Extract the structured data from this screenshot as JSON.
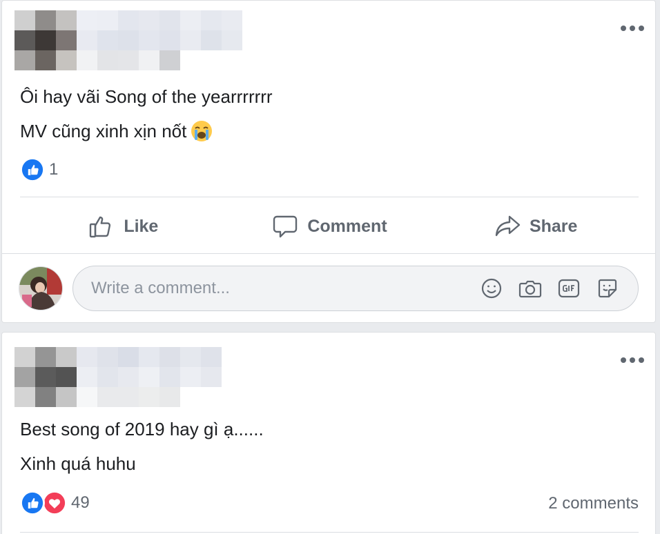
{
  "posts": [
    {
      "lines": [
        "Ôi hay vãi Song of the yearrrrrrr",
        "MV cũng xinh xịn nốt"
      ],
      "line2_emoji": "loudly-crying-face",
      "reaction_icons": [
        "like-icon"
      ],
      "reaction_count": "1",
      "actions": {
        "like": "Like",
        "comment": "Comment",
        "share": "Share"
      },
      "comment_placeholder": "Write a comment...",
      "comment_tools": [
        "emoji-icon",
        "camera-icon",
        "gif-icon",
        "sticker-icon"
      ]
    },
    {
      "lines": [
        "Best song of 2019 hay gì ạ......",
        "Xinh quá huhu"
      ],
      "reaction_icons": [
        "like-icon",
        "love-icon"
      ],
      "reaction_count": "49",
      "comments_count": "2 comments"
    }
  ],
  "colors": {
    "like_blue": "#1877f2",
    "love_red": "#f33e58",
    "icon_gray": "#606770",
    "text": "#1c1e21",
    "secondary_text": "#606770",
    "page_bg": "#e9ebee"
  }
}
